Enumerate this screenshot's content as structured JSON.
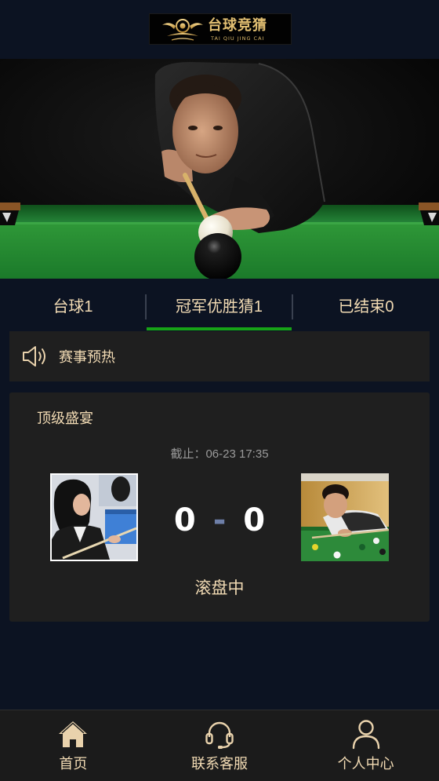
{
  "header": {
    "logo_title": "台球竞猜",
    "logo_subtitle": "TAI QIU JING CAI"
  },
  "banner": {
    "image": "snooker-player-aiming-cue-ball"
  },
  "tabs": [
    {
      "label": "台球1",
      "active": false
    },
    {
      "label": "冠军优胜猜1",
      "active": true
    },
    {
      "label": "已结束0",
      "active": false
    }
  ],
  "notice": {
    "icon": "speaker-icon",
    "text": "赛事预热"
  },
  "match": {
    "title": "顶级盛宴",
    "deadline_label": "截止：",
    "deadline": "06-23 17:35",
    "home_image": "female-pool-player-photo",
    "away_image": "snooker-player-photo",
    "home_score": "0",
    "separator": "-",
    "away_score": "0",
    "status": "滚盘中"
  },
  "nav": [
    {
      "icon": "home-icon",
      "label": "首页"
    },
    {
      "icon": "headset-icon",
      "label": "联系客服"
    },
    {
      "icon": "user-icon",
      "label": "个人中心"
    }
  ],
  "colors": {
    "page_bg": "#0c1322",
    "panel_bg": "#1f1f1f",
    "nav_bg": "#1b1b1b",
    "text_gold": "#f2dbb4",
    "text_muted": "#9a9a9a",
    "accent_green": "#17a317",
    "score_text": "#ffffff",
    "score_separator": "#6e7fa8",
    "icon_gold": "#e9d2ac"
  }
}
